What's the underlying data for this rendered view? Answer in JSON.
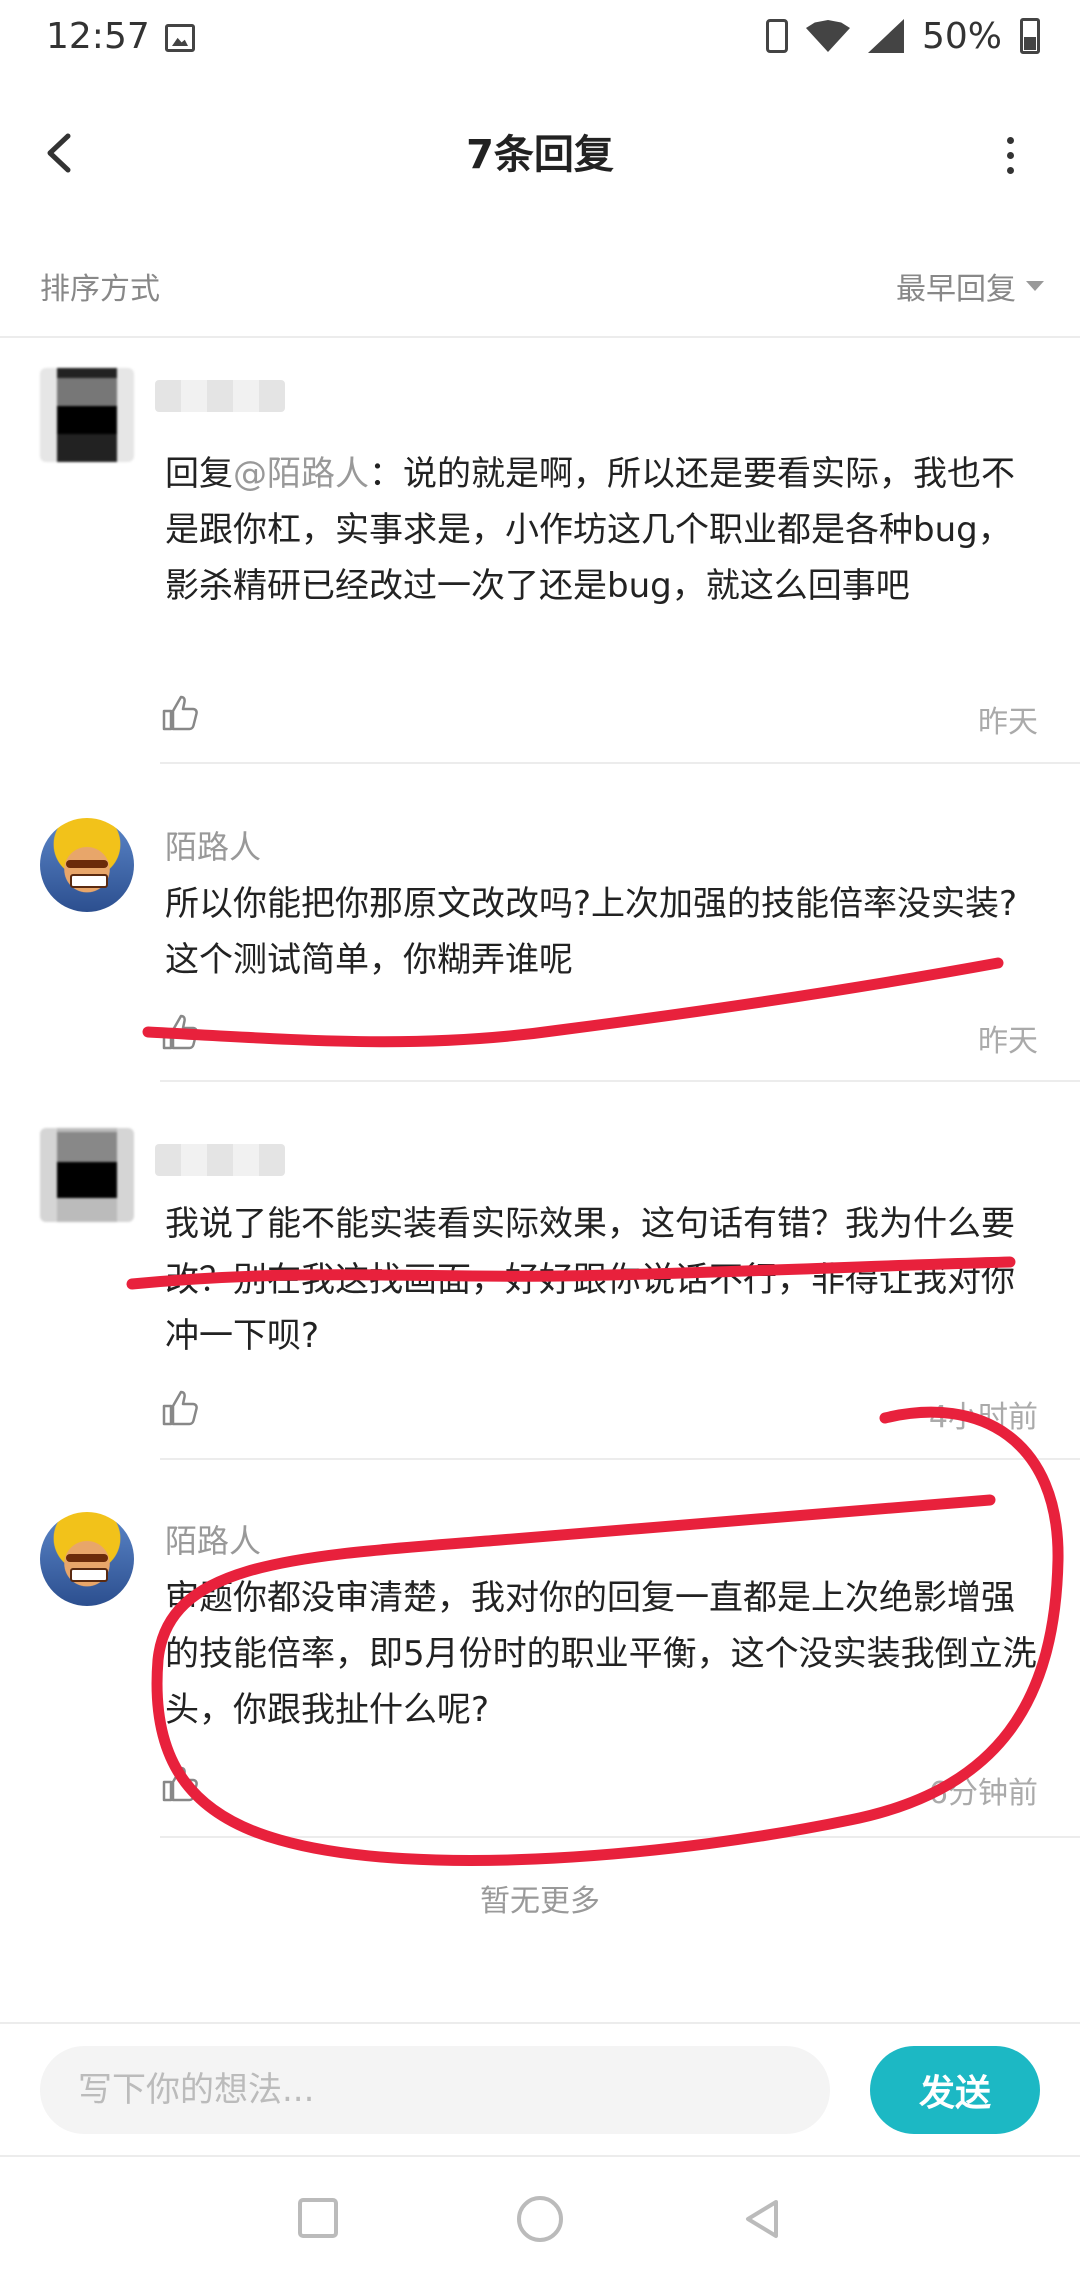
{
  "status_bar": {
    "time": "12:57",
    "battery": "50%"
  },
  "header": {
    "title": "7条回复"
  },
  "sort": {
    "label": "排序方式",
    "selected": "最早回复"
  },
  "comments": [
    {
      "username": "",
      "mention": "@陌路人",
      "text_prefix": "回复",
      "text": "：说的就是啊，所以还是要看实际，我也不是跟你杠，实事求是，小作坊这几个职业都是各种bug，影杀精研已经改过一次了还是bug，就这么回事吧",
      "time": "昨天"
    },
    {
      "username": "陌路人",
      "text": "所以你能把你那原文改改吗?上次加强的技能倍率没实装?这个测试简单，你糊弄谁呢",
      "time": "昨天"
    },
    {
      "username": "",
      "text": "我说了能不能实装看实际效果，这句话有错？我为什么要改？别在我这找画面，好好跟你说话不行，非得让我对你冲一下呗?",
      "time": "4小时前"
    },
    {
      "username": "陌路人",
      "text": "审题你都没审清楚，我对你的回复一直都是上次绝影增强的技能倍率，即5月份时的职业平衡，这个没实装我倒立洗头，你跟我扯什么呢?",
      "time": "6分钟前"
    }
  ],
  "footer": {
    "no_more": "暂无更多"
  },
  "input": {
    "placeholder": "写下你的想法...",
    "send_label": "发送"
  },
  "colors": {
    "accent": "#1cb8c4",
    "annotation": "#e8213c"
  }
}
